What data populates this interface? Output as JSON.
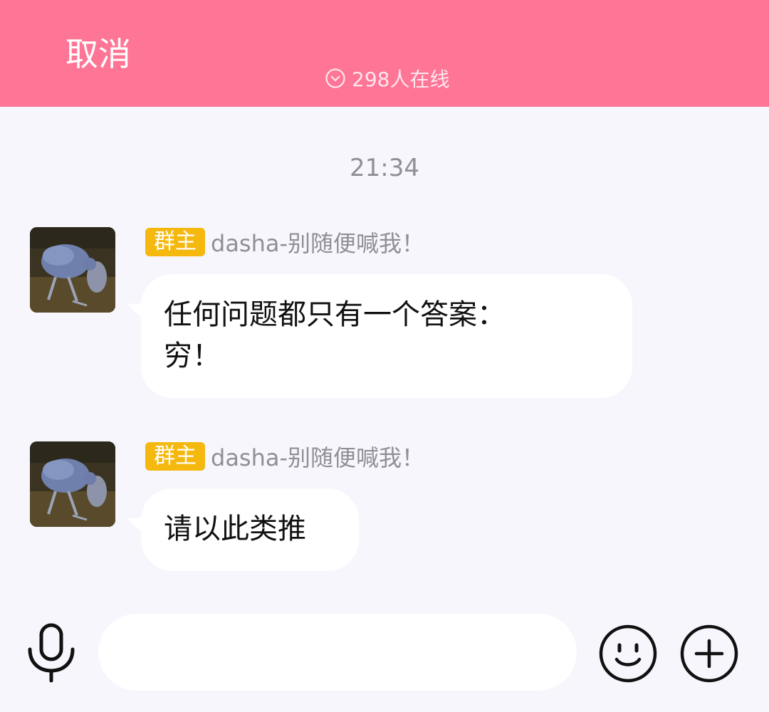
{
  "header": {
    "cancel_label": "取消",
    "online_text": "298人在线",
    "background_color": "#ff7595"
  },
  "chat": {
    "timestamp": "21:34",
    "messages": [
      {
        "role_badge": "群主",
        "sender": "dasha-别随便喊我！",
        "text_lines": [
          "任何问题都只有一个答案：",
          "穷！"
        ]
      },
      {
        "role_badge": "群主",
        "sender": "dasha-别随便喊我！",
        "text_lines": [
          "请以此类推"
        ]
      }
    ]
  },
  "inputbar": {
    "value": "",
    "placeholder": "",
    "icons": [
      "microphone-icon",
      "emoji-icon",
      "plus-icon"
    ]
  },
  "colors": {
    "badge": "#f5b80f",
    "chat_background": "#f6f6fc",
    "bubble": "#ffffff"
  }
}
